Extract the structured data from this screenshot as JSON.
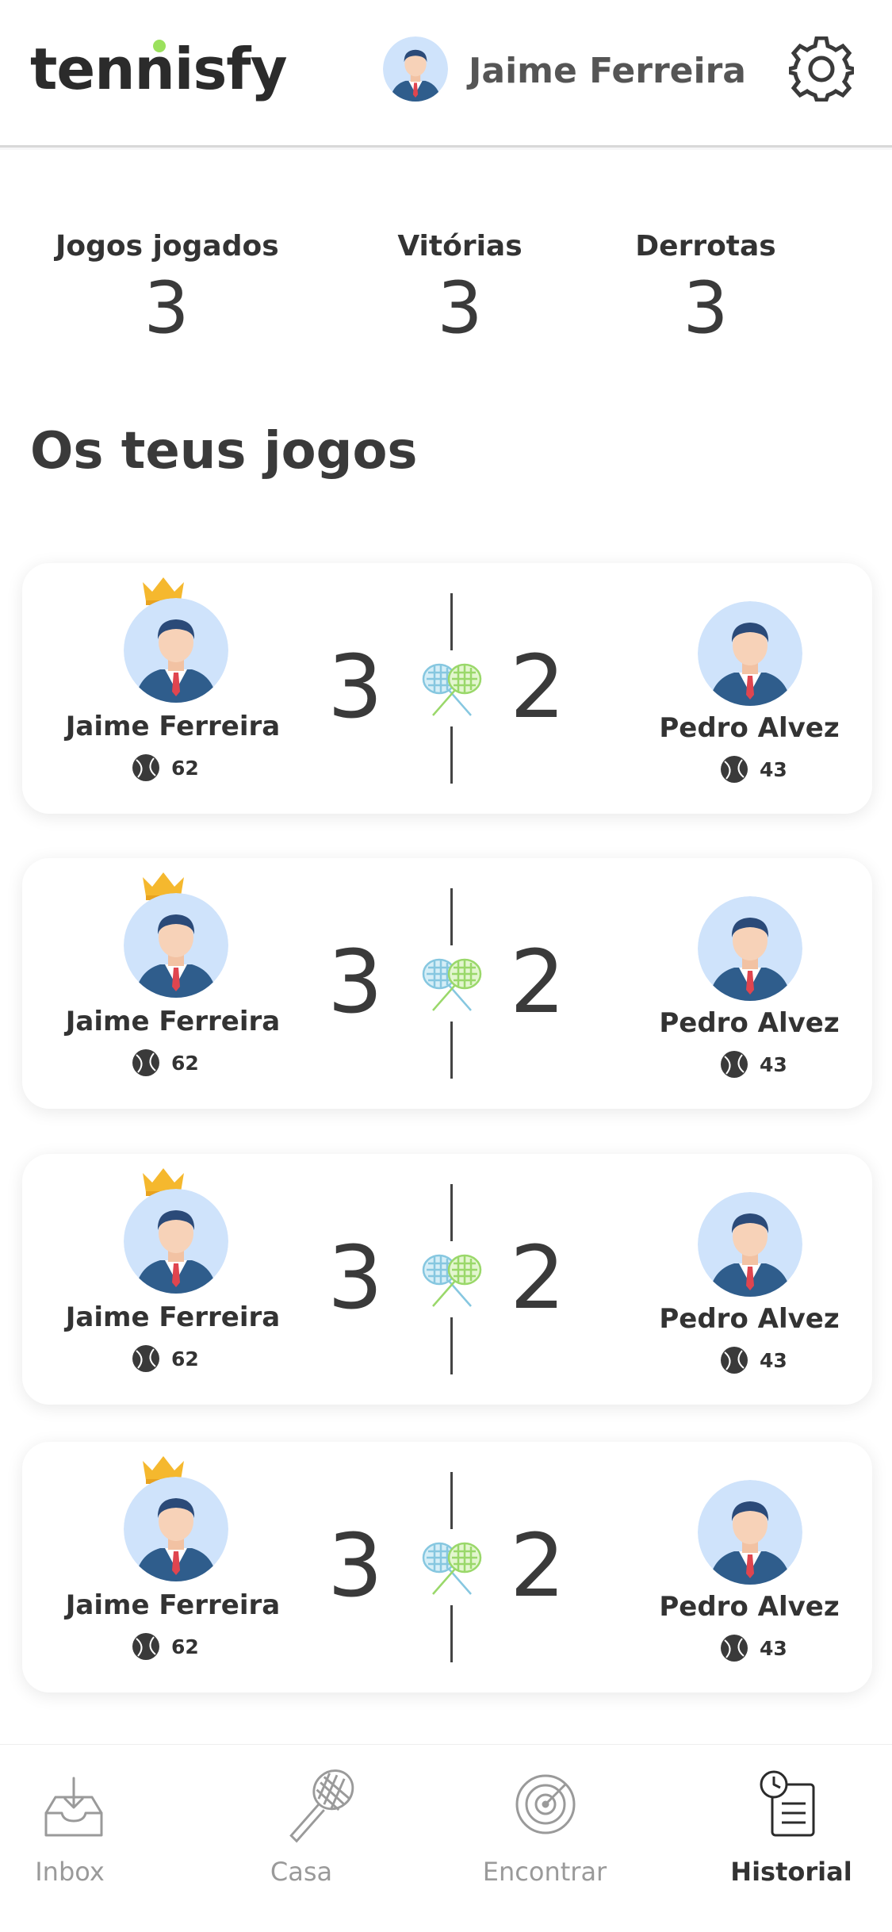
{
  "header": {
    "logo": "tennisfy",
    "user_name": "Jaime Ferreira"
  },
  "stats": [
    {
      "label": "Jogos jogados",
      "value": "3"
    },
    {
      "label": "Vitórias",
      "value": "3"
    },
    {
      "label": "Derrotas",
      "value": "3"
    }
  ],
  "section_title": "Os teus jogos",
  "matches": [
    {
      "left_name": "Jaime Ferreira",
      "left_rating": "62",
      "left_score": "3",
      "right_score": "2",
      "right_name": "Pedro Alvez",
      "right_rating": "43"
    },
    {
      "left_name": "Jaime Ferreira",
      "left_rating": "62",
      "left_score": "3",
      "right_score": "2",
      "right_name": "Pedro Alvez",
      "right_rating": "43"
    },
    {
      "left_name": "Jaime Ferreira",
      "left_rating": "62",
      "left_score": "3",
      "right_score": "2",
      "right_name": "Pedro Alvez",
      "right_rating": "43"
    },
    {
      "left_name": "Jaime Ferreira",
      "left_rating": "62",
      "left_score": "3",
      "right_score": "2",
      "right_name": "Pedro Alvez",
      "right_rating": "43"
    }
  ],
  "nav": [
    {
      "label": "Inbox",
      "icon": "inbox-icon",
      "active": false
    },
    {
      "label": "Casa",
      "icon": "tennis-racket-icon",
      "active": false
    },
    {
      "label": "Encontrar",
      "icon": "radar-icon",
      "active": false
    },
    {
      "label": "Historial",
      "icon": "history-clipboard-icon",
      "active": true
    }
  ],
  "colors": {
    "accent_green": "#9be15d",
    "crown": "#f5b82e",
    "avatar_bg": "#cfe3fb",
    "suit": "#2f5d8c",
    "tie": "#e0454f"
  }
}
